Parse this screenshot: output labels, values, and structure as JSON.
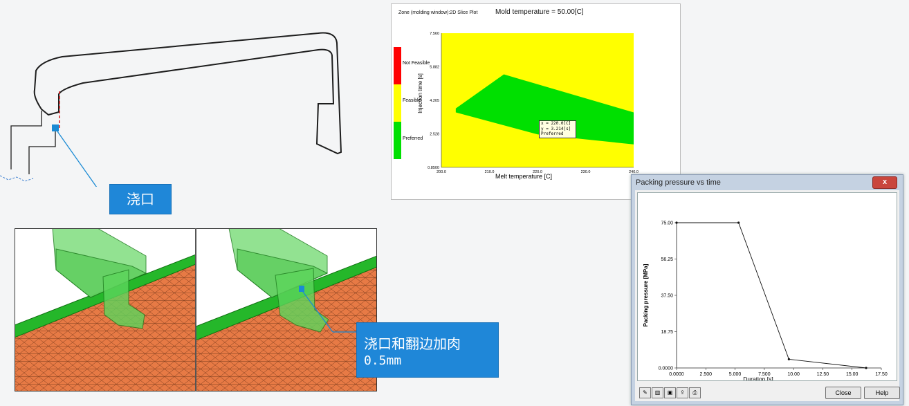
{
  "callouts": {
    "gate": "浇口",
    "gate_flange_line1": "浇口和翻边加肉",
    "gate_flange_line2": "0.5mm"
  },
  "slice_plot": {
    "window_title": "Zone (molding window):2D Slice Plot",
    "header": "Mold temperature = 50.00[C]",
    "legend": [
      {
        "label": "Not Feasible",
        "color": "#ff0000"
      },
      {
        "label": "Feasible",
        "color": "#ffff00"
      },
      {
        "label": "Preferred",
        "color": "#00e000"
      }
    ],
    "tooltip": {
      "line1": "x = 220.0[C]",
      "line2": "y = 3.214[s]",
      "line3": "Preferred"
    },
    "y_ticks": [
      "7.560",
      "5.882",
      "4.205",
      "2.528",
      "0.8500"
    ],
    "x_ticks": [
      "200.0",
      "210.0",
      "220.0",
      "230.0",
      "240.0"
    ]
  },
  "packing_dialog": {
    "title": "Packing pressure vs time",
    "close_x": "x",
    "close_button": "Close",
    "help_button": "Help",
    "toolbar_icons": [
      "edit-icon",
      "columns-icon",
      "save-icon",
      "export-icon",
      "print-icon"
    ]
  },
  "chart_data": [
    {
      "type": "heatmap",
      "title": "Mold temperature = 50.00[C]",
      "xlabel": "Melt temperature [C]",
      "ylabel": "Injection time [s]",
      "xlim": [
        200.0,
        240.0
      ],
      "ylim": [
        0.85,
        7.56
      ],
      "x_ticks": [
        200.0,
        210.0,
        220.0,
        230.0,
        240.0
      ],
      "y_ticks": [
        0.85,
        2.528,
        4.205,
        5.882,
        7.56
      ],
      "categories": [
        "Not Feasible",
        "Feasible",
        "Preferred"
      ],
      "preferred_region": {
        "x": [
          203.0,
          213.0,
          240.0,
          240.0,
          220.0,
          203.0
        ],
        "y": [
          3.8,
          5.5,
          3.6,
          2.0,
          2.5,
          3.6
        ]
      },
      "annotation": {
        "x": 220.0,
        "y": 3.214,
        "label": "Preferred"
      }
    },
    {
      "type": "line",
      "title": "",
      "xlabel": "Duration [s]",
      "ylabel": "Packing pressure [MPa]",
      "xlim": [
        0,
        17.5
      ],
      "ylim": [
        0,
        75
      ],
      "x_ticks": [
        "0.0000",
        "2.500",
        "5.000",
        "7.500",
        "10.00",
        "12.50",
        "15.00",
        "17.50"
      ],
      "y_ticks": [
        "0.0000",
        "18.75",
        "37.50",
        "56.25",
        "75.00"
      ],
      "series": [
        {
          "x": [
            0,
            5.3,
            9.6,
            16.2
          ],
          "y": [
            75,
            75,
            4.5,
            0
          ]
        }
      ]
    }
  ]
}
